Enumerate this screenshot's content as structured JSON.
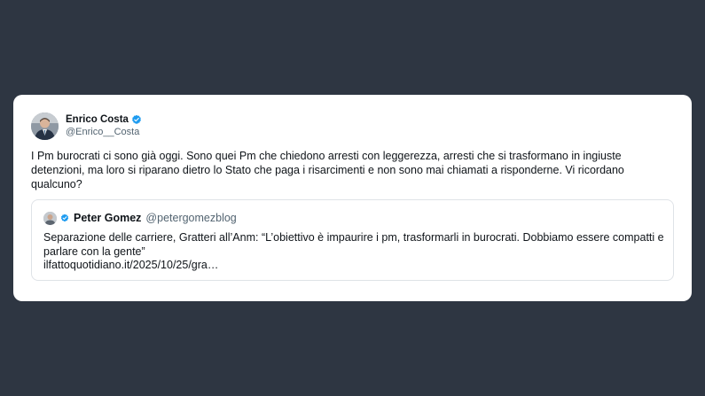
{
  "colors": {
    "background": "#2e3642",
    "card": "#ffffff",
    "verified_badge": "#1d9bf0",
    "handle_text": "#536471",
    "quote_border": "#dfe3e7"
  },
  "tweet": {
    "author": {
      "display_name": "Enrico Costa",
      "handle": "@Enrico__Costa",
      "avatar_icon": "profile-photo",
      "verified_icon": "verified-badge-icon"
    },
    "text": "I Pm burocrati ci sono già oggi.  Sono quei Pm che chiedono arresti con leggerezza, arresti che si trasformano in ingiuste detenzioni, ma loro si riparano dietro lo Stato che paga i risarcimenti e non sono mai chiamati a risponderne. Vi ricordano qualcuno?",
    "quoted": {
      "display_name": "Peter Gomez",
      "handle": "@petergomezblog",
      "avatar_icon": "profile-photo",
      "verified_icon": "verified-badge-icon",
      "text": "Separazione delle carriere, Gratteri all’Anm: “L’obiettivo è impaurire i pm, trasformarli in burocrati. Dobbiamo essere compatti e parlare con la gente”",
      "link": "ilfattoquotidiano.it/2025/10/25/gra…"
    }
  }
}
